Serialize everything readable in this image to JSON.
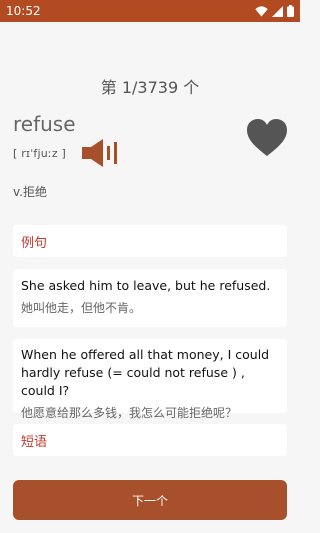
{
  "status_bar": {
    "time": "10:52"
  },
  "header": {
    "page_counter": "第 1/3739 个"
  },
  "word": {
    "text": "refuse",
    "phonetic": "[ rɪˈfjuːz ]",
    "meaning": "v.拒绝"
  },
  "sections": {
    "examples_title": "例句",
    "phrases_title": "短语"
  },
  "examples": [
    {
      "en": "She asked him to leave, but he refused.",
      "zh": "她叫他走，但他不肯。"
    },
    {
      "en": "When he offered all that money, I could hardly refuse (= could not refuse ) , could I?",
      "zh": "他愿意给那么多钱，我怎么可能拒绝呢？"
    }
  ],
  "buttons": {
    "next_label": "下一个"
  },
  "colors": {
    "accent": "#a84f2b",
    "status_bar": "#b24a22",
    "section_title": "#c0392b"
  },
  "icons": [
    "wifi-icon",
    "signal-icon",
    "battery-icon",
    "speaker-icon",
    "heart-icon"
  ]
}
